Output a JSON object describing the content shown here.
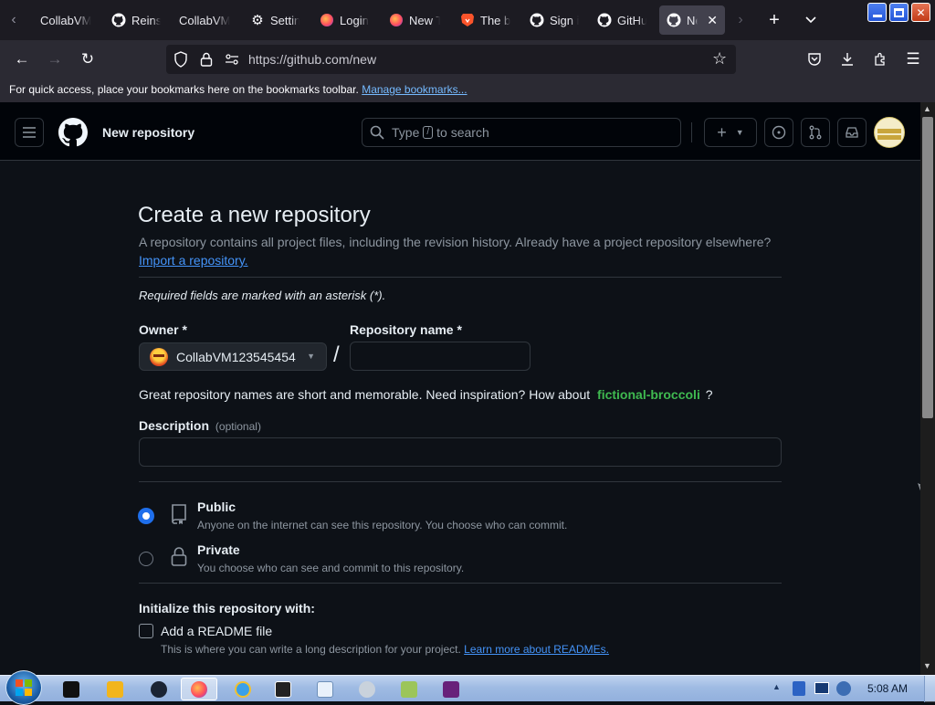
{
  "browser": {
    "tabs": [
      {
        "label": "CollabVM",
        "icon": "collabvm-icon"
      },
      {
        "label": "Reinst",
        "icon": "github-icon"
      },
      {
        "label": "CollabVM",
        "icon": "collabvm-icon"
      },
      {
        "label": "Settin",
        "icon": "gear-icon"
      },
      {
        "label": "Login",
        "icon": "firefox-icon"
      },
      {
        "label": "New T",
        "icon": "firefox-icon"
      },
      {
        "label": "The b",
        "icon": "brave-icon"
      },
      {
        "label": "Sign i",
        "icon": "github-icon"
      },
      {
        "label": "GitHu",
        "icon": "github-icon"
      },
      {
        "label": "Ne",
        "icon": "github-icon",
        "active": true
      }
    ],
    "url": "https://github.com/new",
    "bookmarks_message": "For quick access, place your bookmarks here on the bookmarks toolbar.",
    "bookmarks_link": "Manage bookmarks..."
  },
  "github_header": {
    "title": "New repository",
    "search_prefix": "Type",
    "search_key": "/",
    "search_suffix": "to search",
    "plus_label": "+"
  },
  "page": {
    "heading": "Create a new repository",
    "subtitle": "A repository contains all project files, including the revision history. Already have a project repository elsewhere?",
    "import_link": "Import a repository.",
    "required_note": "Required fields are marked with an asterisk (*).",
    "owner_label": "Owner *",
    "owner_value": "CollabVM123545454",
    "repo_name_label": "Repository name *",
    "repo_name_value": "",
    "slash": "/",
    "inspiration_text": "Great repository names are short and memorable. Need inspiration? How about",
    "suggestion": "fictional-broccoli",
    "suggestion_tail": "?",
    "description_label": "Description",
    "description_optional": "(optional)",
    "description_value": "",
    "visibility": [
      {
        "label": "Public",
        "desc": "Anyone on the internet can see this repository. You choose who can commit.",
        "selected": true,
        "icon": "repo-icon"
      },
      {
        "label": "Private",
        "desc": "You choose who can see and commit to this repository.",
        "selected": false,
        "icon": "lock-icon"
      }
    ],
    "init_heading": "Initialize this repository with:",
    "readme_label": "Add a README file",
    "readme_desc": "This is where you can write a long description for your project.",
    "readme_link": "Learn more about READMEs."
  },
  "taskbar": {
    "clock": "5:08 AM"
  },
  "colors": {
    "accent_blue": "#4493f8",
    "suggestion_green": "#3fb950",
    "bg": "#0d1117"
  }
}
